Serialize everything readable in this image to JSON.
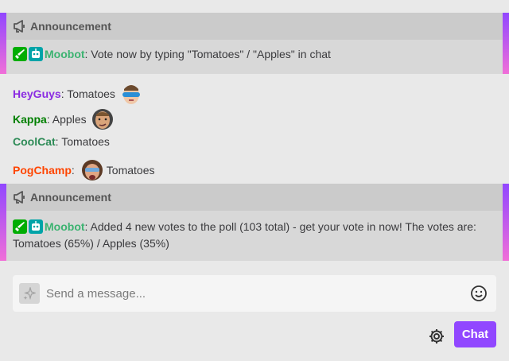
{
  "announcements": [
    {
      "label": "Announcement",
      "user": "Moobot",
      "user_color": "#3cb371",
      "text": ": Vote now by typing \"Tomatoes\" / \"Apples\" in chat"
    },
    {
      "label": "Announcement",
      "user": "Moobot",
      "user_color": "#3cb371",
      "text": ": Added 4 new votes to the poll (103 total) - get your vote in now! The votes are: Tomatoes (65%) / Apples (35%)"
    }
  ],
  "messages": [
    {
      "user": "HeyGuys",
      "color": "#8a2be2",
      "text": ": Tomatoes",
      "emote": "heyguys-emote"
    },
    {
      "user": "Kappa",
      "color": "#008000",
      "text": ": Apples",
      "emote": "kappa-emote"
    },
    {
      "user": "CoolCat",
      "color": "#2e8b57",
      "text": ": Tomatoes"
    },
    {
      "user": "PogChamp",
      "color": "#ff4500",
      "text": "Tomatoes",
      "sep": ":",
      "emote": "pogchamp-emote"
    }
  ],
  "input": {
    "placeholder": "Send a message..."
  },
  "chat_button": "Chat",
  "colors": {
    "accent": "#9147ff",
    "announcement_gradient_start": "#9147ff",
    "announcement_gradient_end": "#f06fd8"
  },
  "icons": [
    "megaphone-icon",
    "moderator-sword-icon",
    "bot-icon",
    "sparkle-icon",
    "emoji-smile-icon",
    "gear-icon"
  ]
}
